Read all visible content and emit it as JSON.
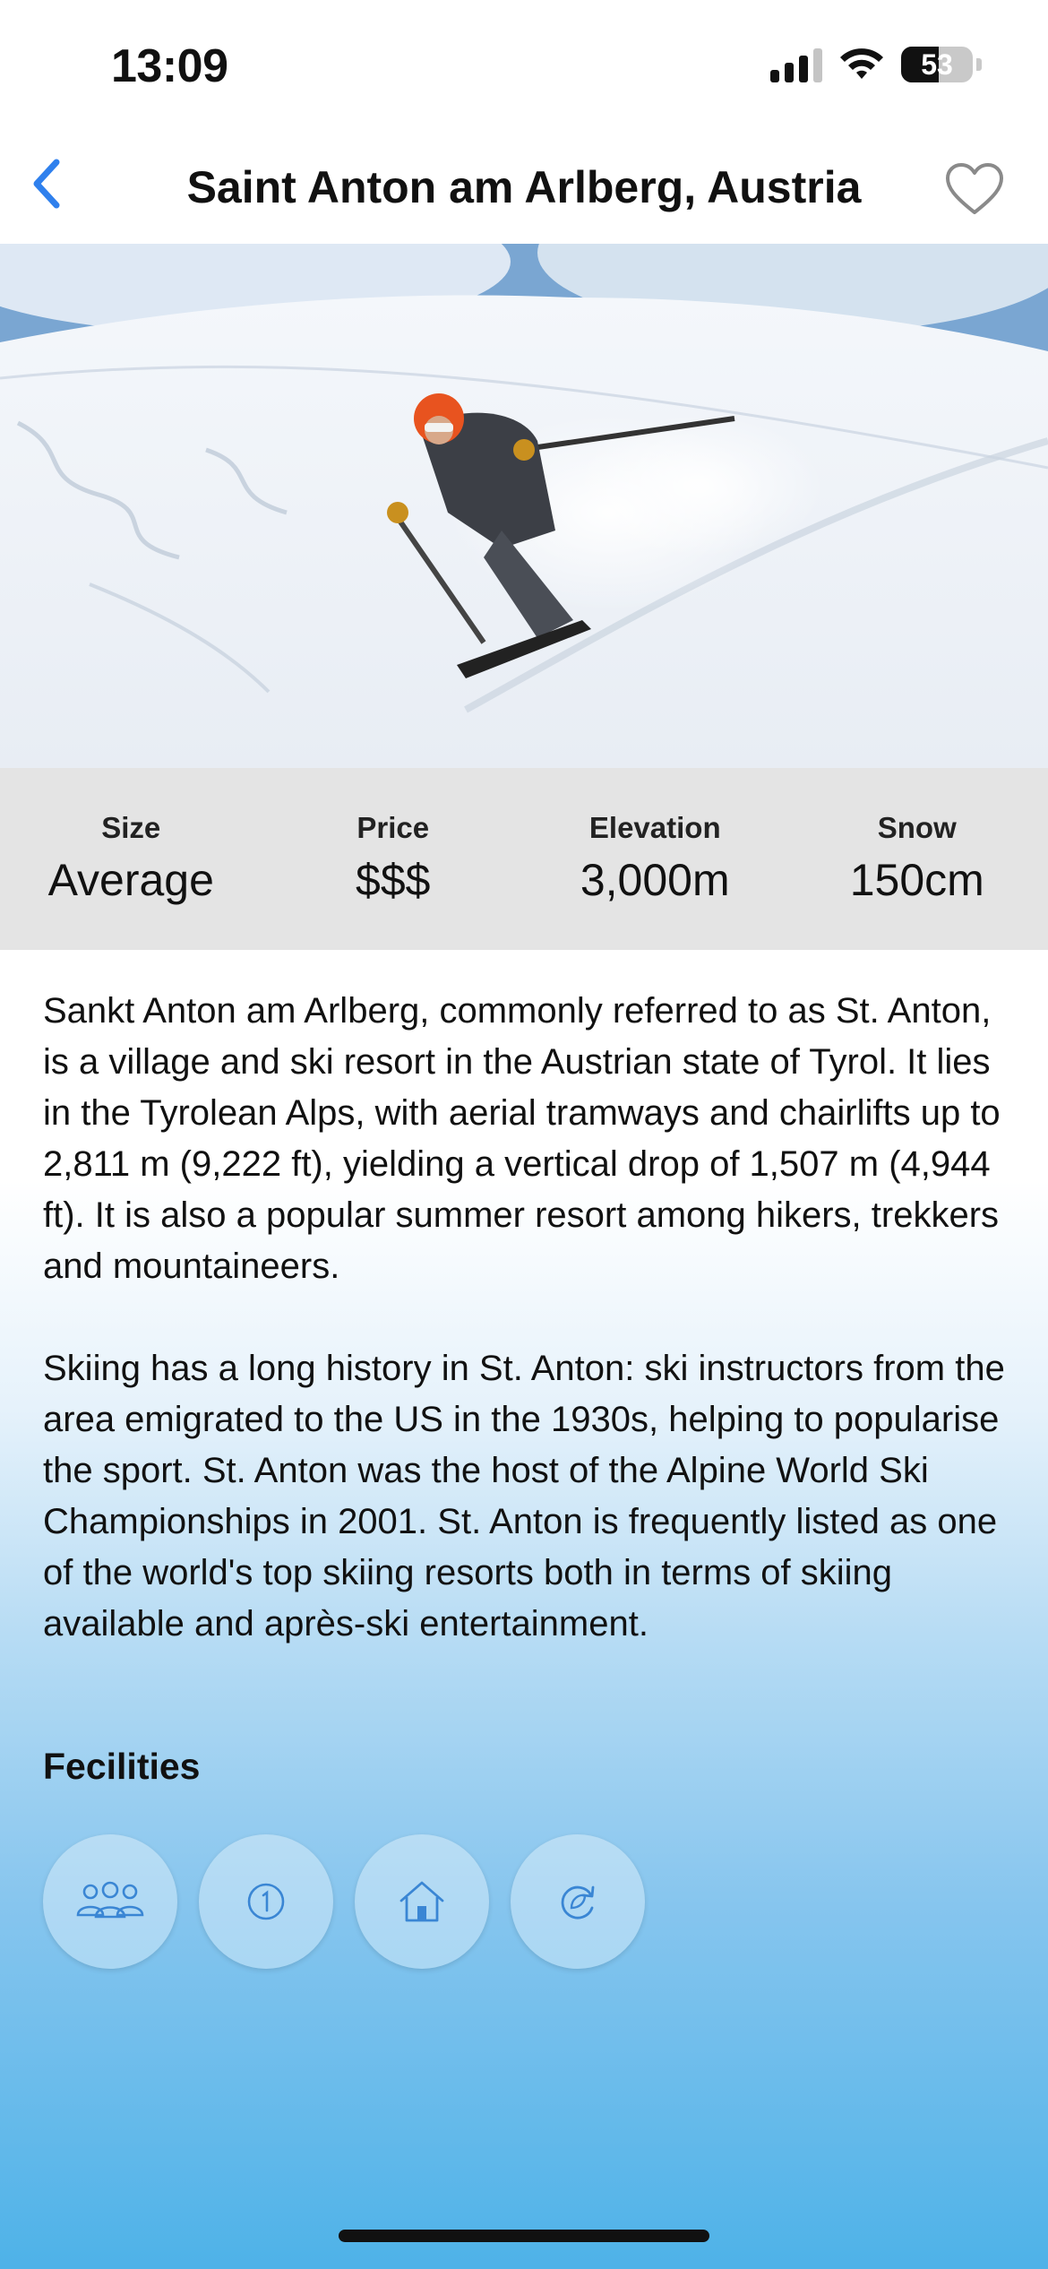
{
  "status_bar": {
    "time": "13:09",
    "battery": "53"
  },
  "nav": {
    "title": "Saint Anton am Arlberg, Austria"
  },
  "hero": {
    "image_alt": "skier carving down a snowy slope"
  },
  "stats": [
    {
      "label": "Size",
      "value": "Average"
    },
    {
      "label": "Price",
      "value": "$$$"
    },
    {
      "label": "Elevation",
      "value": "3,000m"
    },
    {
      "label": "Snow",
      "value": "150cm"
    }
  ],
  "description": [
    "Sankt Anton am Arlberg, commonly referred to as St. Anton, is a village and ski resort in the Austrian state of Tyrol. It lies in the Tyrolean Alps, with aerial tramways and chairlifts up to 2,811 m (9,222 ft), yielding a vertical drop of 1,507 m (4,944 ft). It is also a popular summer resort among hikers, trekkers and mountaineers.",
    "Skiing has a long history in St. Anton: ski instructors from the area emigrated to the US in the 1930s, helping to popularise the sport. St. Anton was the host of the Alpine World Ski Championships in 2001. St. Anton is frequently listed as one of the world's top skiing resorts both in terms of skiing available and après-ski entertainment."
  ],
  "facilities": {
    "title": "Fecilities",
    "icons": [
      "group-icon",
      "info-number-icon",
      "home-icon",
      "eco-refresh-icon"
    ]
  },
  "colors": {
    "accent": "#2f80ed",
    "stats_bg": "#e4e4e4",
    "gradient_bottom": "#4eb2e8"
  }
}
